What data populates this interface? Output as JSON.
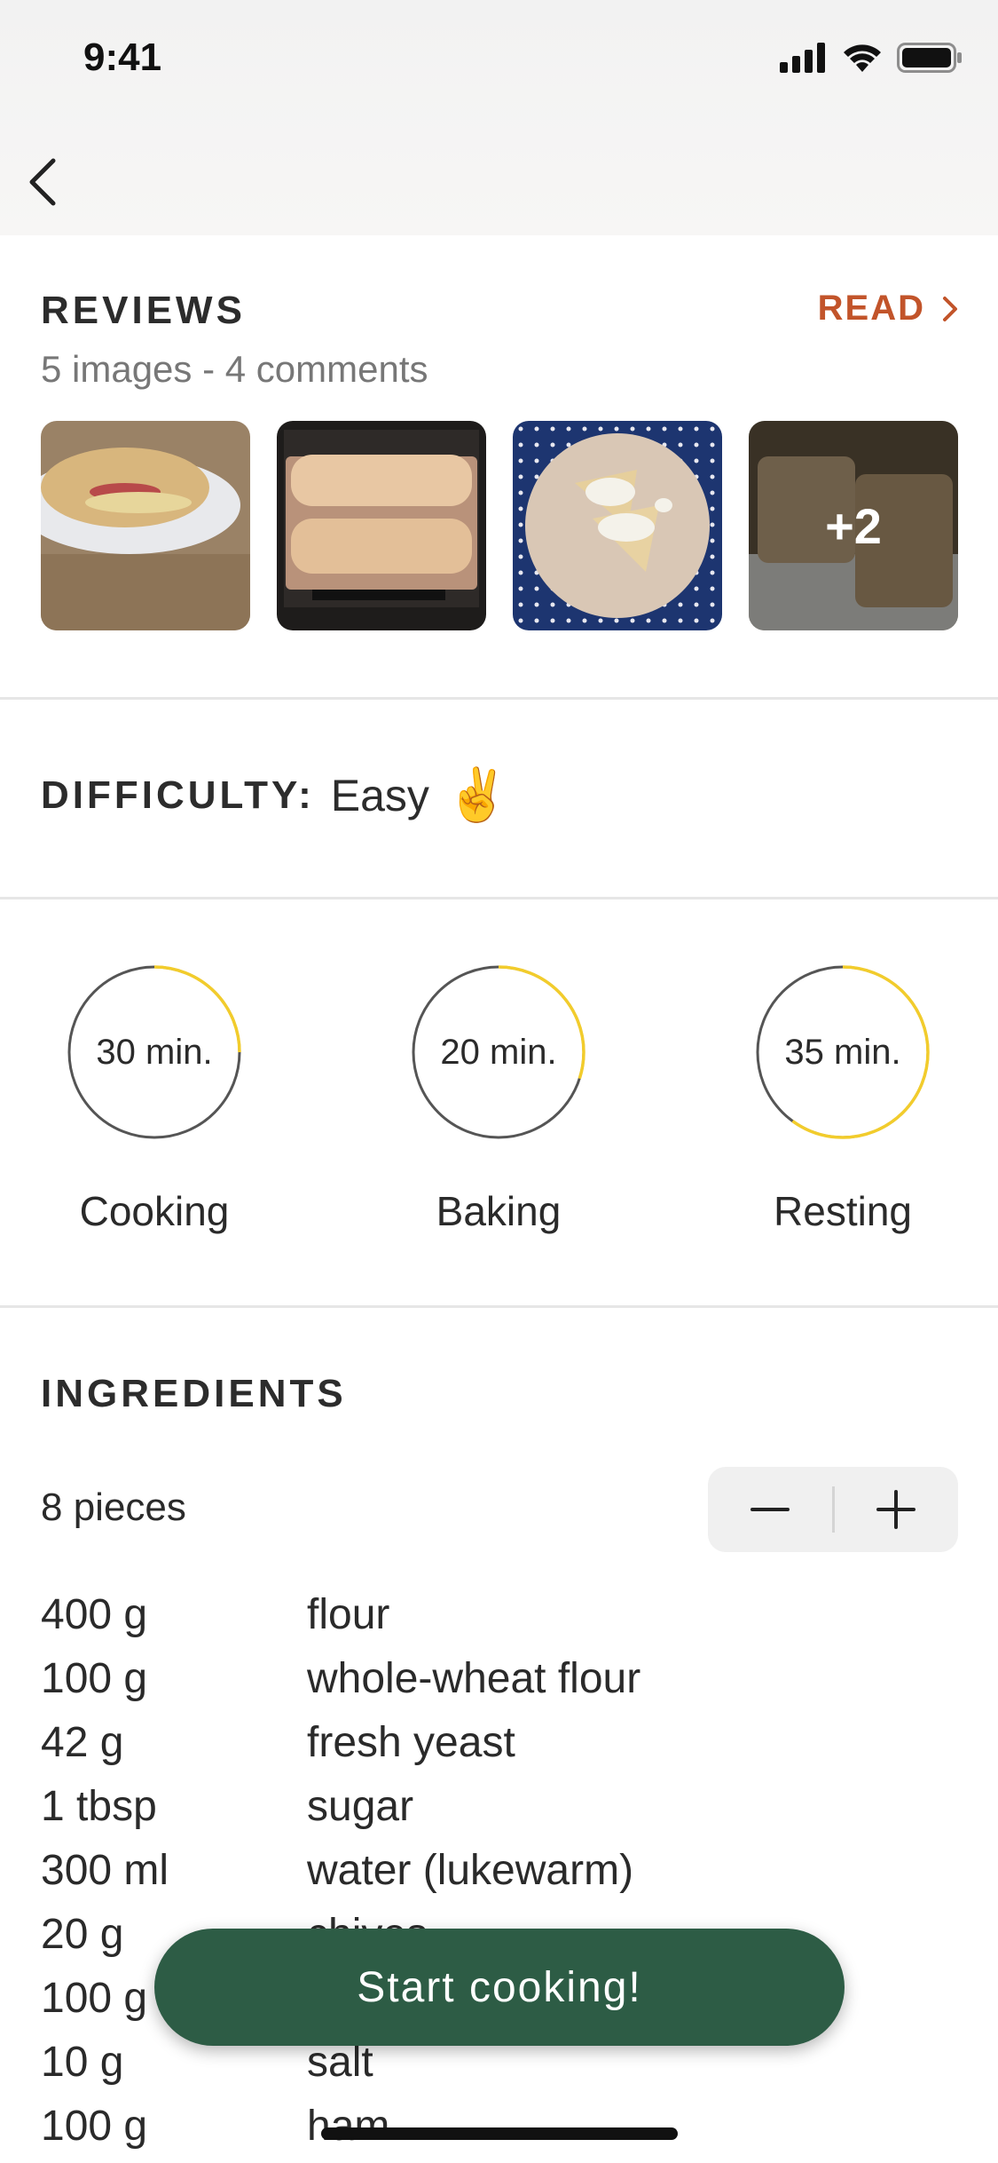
{
  "status_bar": {
    "time": "9:41"
  },
  "reviews": {
    "title": "REVIEWS",
    "read_label": "READ",
    "subtitle": "5 images - 4 comments",
    "more_count": "+2"
  },
  "difficulty": {
    "label": "DIFFICULTY:",
    "value": "Easy",
    "emoji": "✌️"
  },
  "timers": [
    {
      "value": "30 min.",
      "label": "Cooking",
      "progress": 0.25
    },
    {
      "value": "20 min.",
      "label": "Baking",
      "progress": 0.3
    },
    {
      "value": "35 min.",
      "label": "Resting",
      "progress": 0.6
    }
  ],
  "colors": {
    "accent": "#c2542a",
    "progress": "#f2cc2c",
    "cta": "#2d5c45"
  },
  "ingredients": {
    "title": "INGREDIENTS",
    "servings": "8 pieces",
    "items": [
      {
        "amount": "400 g",
        "name": "flour"
      },
      {
        "amount": "100 g",
        "name": "whole-wheat flour"
      },
      {
        "amount": "42 g",
        "name": "fresh yeast"
      },
      {
        "amount": "1 tbsp",
        "name": "sugar"
      },
      {
        "amount": "300 ml",
        "name": "water (lukewarm)"
      },
      {
        "amount": "20 g",
        "name": "chives"
      },
      {
        "amount": "100 g",
        "name": ""
      },
      {
        "amount": "10 g",
        "name": "salt"
      },
      {
        "amount": "100 g",
        "name": "ham"
      }
    ]
  },
  "cta": {
    "label": "Start cooking!"
  }
}
